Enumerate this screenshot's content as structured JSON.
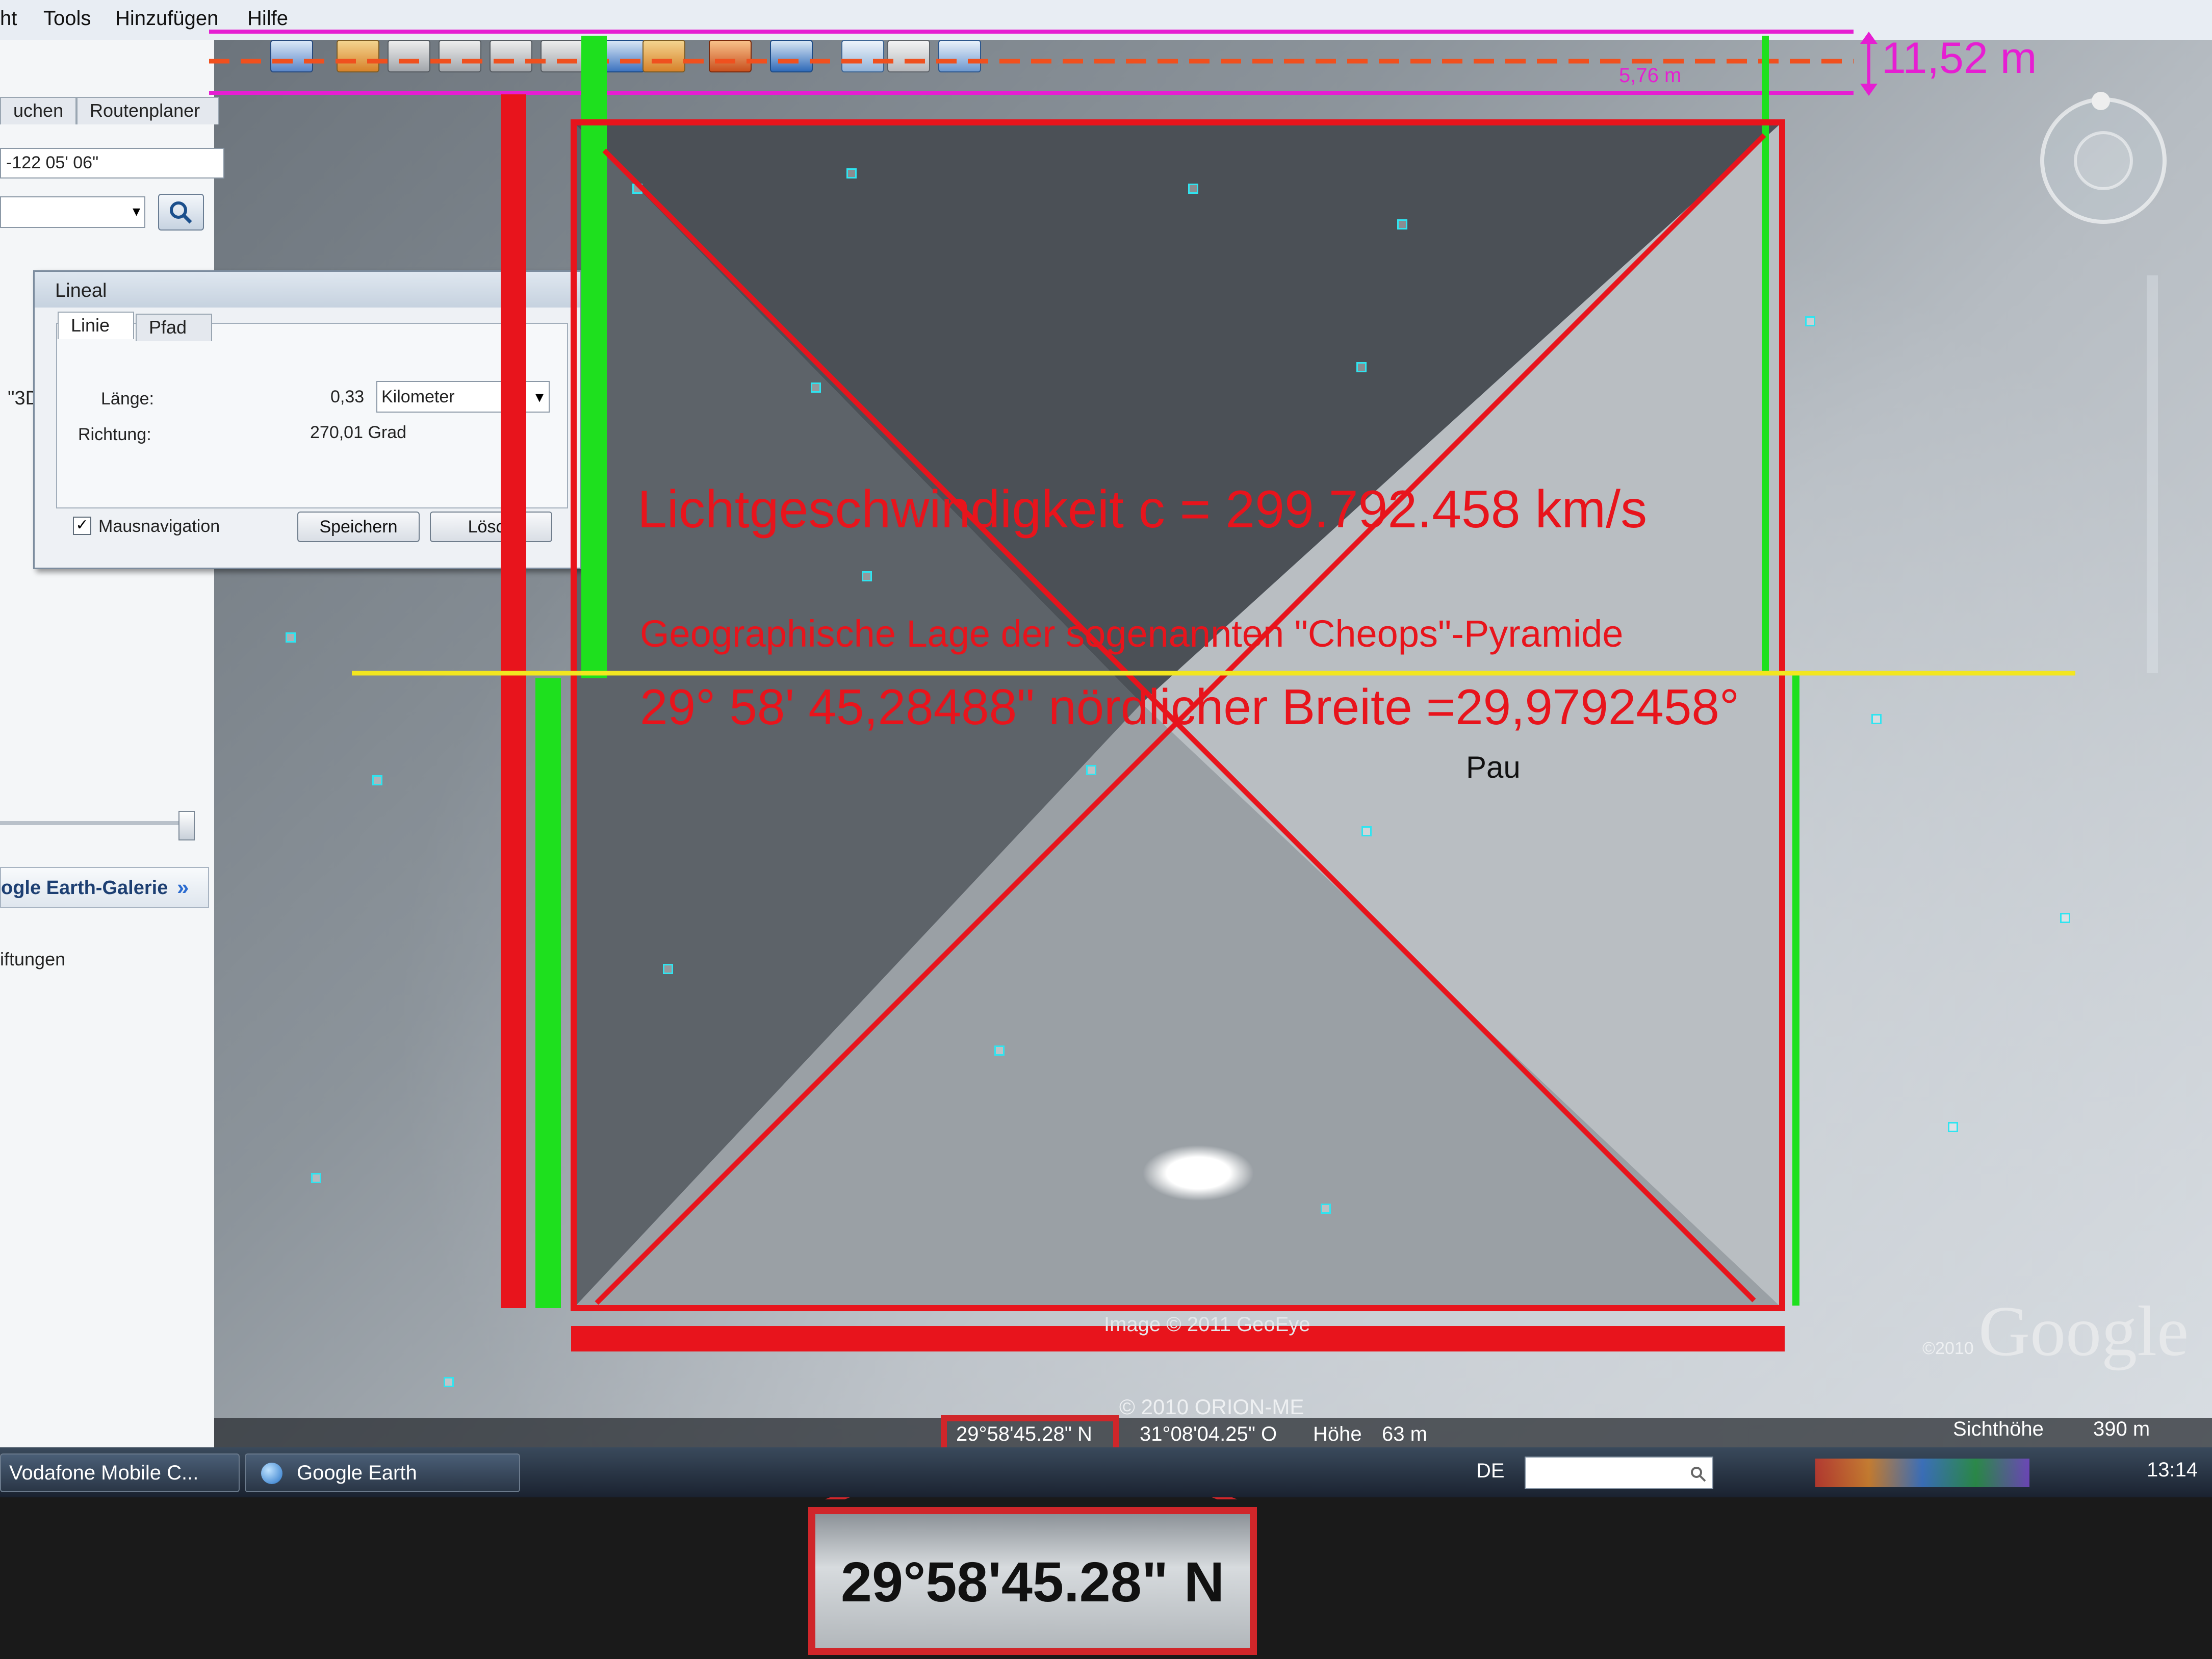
{
  "menubar": {
    "items": [
      "ht",
      "Tools",
      "Hinzufügen",
      "Hilfe"
    ]
  },
  "sidebar": {
    "tabs": [
      "uchen",
      "Routenplaner"
    ],
    "coordinate_value": "-122 05' 06\"",
    "label_3d": "\"3D",
    "gallery_link": "ogle Earth-Galerie",
    "gallery_chevron": "»",
    "bottom_label": "iftungen"
  },
  "ruler_dialog": {
    "title": "Lineal",
    "tabs": [
      "Linie",
      "Pfad"
    ],
    "length_label": "Länge:",
    "length_value": "0,33",
    "unit_selected": "Kilometer",
    "direction_label": "Richtung:",
    "direction_value": "270,01 Grad",
    "mouse_nav_label": "Mausnavigation",
    "mouse_nav_checked": true,
    "save_button": "Speichern",
    "delete_button": "Lösch"
  },
  "overlay": {
    "top_measure": "11,52 m",
    "half_measure": "5,76 m",
    "speed_of_light": "Lichtgeschwindigkeit  c = 299.792.458 km/s",
    "location_caption": "Geographische Lage der sogenannten \"Cheops\"-Pyramide",
    "latitude_caption": "29° 58' 45,28488\" nördlicher Breite =29,9792458°",
    "place_label": "Pau",
    "zoom_latitude": "29°58'45.28\" N"
  },
  "map": {
    "image_credit": "Image © 2011 GeoEye",
    "copyright": "© 2010 ORION-ME",
    "logo_small": "©2010",
    "logo": "Google"
  },
  "statusbar": {
    "latitude": "29°58'45.28\" N",
    "longitude": "31°08'04.25\" O",
    "altitude_label": "Höhe",
    "altitude_value": "63 m",
    "eye_alt_label": "Sichthöhe",
    "eye_alt_value": "390 m"
  },
  "taskbar": {
    "buttons": [
      "Vodafone Mobile C...",
      "Google Earth"
    ],
    "language": "DE",
    "clock": "13:14"
  },
  "colors": {
    "overlay_red": "#e8141c",
    "overlay_green": "#1ee01e",
    "overlay_magenta": "#e61ed2",
    "overlay_yellow": "#f2e620",
    "overlay_orange": "#f0501e"
  }
}
